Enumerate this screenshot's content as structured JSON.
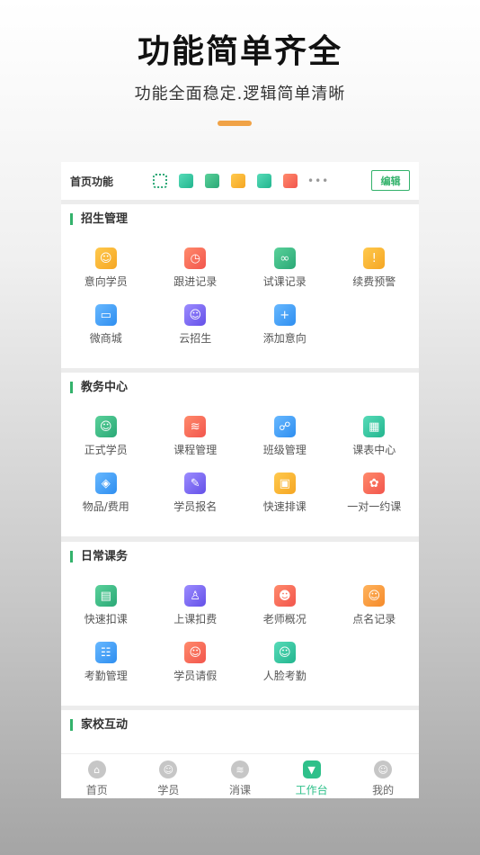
{
  "hero": {
    "title": "功能简单齐全",
    "subtitle": "功能全面稳定.逻辑简单清晰"
  },
  "quickbar": {
    "title": "首页功能",
    "icons": [
      "qrcode-icon",
      "follow-icon",
      "trial-icon",
      "student-icon",
      "teacher-icon",
      "sign-icon"
    ],
    "more": "•••",
    "edit_label": "编辑"
  },
  "sections": [
    {
      "title": "招生管理",
      "items": [
        {
          "label": "意向学员",
          "icon": "intent-student-icon",
          "glyph": "☺",
          "color": "yellow"
        },
        {
          "label": "跟进记录",
          "icon": "follow-record-icon",
          "glyph": "◷",
          "color": "red"
        },
        {
          "label": "试课记录",
          "icon": "trial-record-icon",
          "glyph": "∞",
          "color": "green"
        },
        {
          "label": "续费预警",
          "icon": "renew-alert-icon",
          "glyph": "!",
          "color": "yellow"
        },
        {
          "label": "微商城",
          "icon": "micro-mall-icon",
          "glyph": "▭",
          "color": "blue"
        },
        {
          "label": "云招生",
          "icon": "cloud-recruit-icon",
          "glyph": "☺",
          "color": "purple"
        },
        {
          "label": "添加意向",
          "icon": "add-intent-icon",
          "glyph": "+",
          "color": "blue"
        }
      ]
    },
    {
      "title": "教务中心",
      "items": [
        {
          "label": "正式学员",
          "icon": "formal-student-icon",
          "glyph": "☺",
          "color": "green"
        },
        {
          "label": "课程管理",
          "icon": "course-manage-icon",
          "glyph": "≋",
          "color": "red"
        },
        {
          "label": "班级管理",
          "icon": "class-manage-icon",
          "glyph": "☍",
          "color": "blue"
        },
        {
          "label": "课表中心",
          "icon": "schedule-center-icon",
          "glyph": "▦",
          "color": "teal"
        },
        {
          "label": "物品/费用",
          "icon": "goods-fee-icon",
          "glyph": "◈",
          "color": "blue"
        },
        {
          "label": "学员报名",
          "icon": "student-enroll-icon",
          "glyph": "✎",
          "color": "purple"
        },
        {
          "label": "快速排课",
          "icon": "quick-schedule-icon",
          "glyph": "▣",
          "color": "yellow"
        },
        {
          "label": "一对一约课",
          "icon": "one-on-one-icon",
          "glyph": "✿",
          "color": "red"
        }
      ]
    },
    {
      "title": "日常课务",
      "items": [
        {
          "label": "快速扣课",
          "icon": "quick-deduct-icon",
          "glyph": "▤",
          "color": "green"
        },
        {
          "label": "上课扣费",
          "icon": "class-fee-icon",
          "glyph": "♙",
          "color": "purple"
        },
        {
          "label": "老师概况",
          "icon": "teacher-overview-icon",
          "glyph": "☻",
          "color": "red"
        },
        {
          "label": "点名记录",
          "icon": "rollcall-record-icon",
          "glyph": "☺",
          "color": "orange"
        },
        {
          "label": "考勤管理",
          "icon": "attendance-manage-icon",
          "glyph": "☷",
          "color": "blue"
        },
        {
          "label": "学员请假",
          "icon": "student-leave-icon",
          "glyph": "☺",
          "color": "red"
        },
        {
          "label": "人脸考勤",
          "icon": "face-attendance-icon",
          "glyph": "☺",
          "color": "teal"
        }
      ]
    },
    {
      "title": "家校互动",
      "items": []
    }
  ],
  "tabbar": [
    {
      "label": "首页",
      "icon": "home-icon",
      "glyph": "⌂",
      "active": false
    },
    {
      "label": "学员",
      "icon": "student-tab-icon",
      "glyph": "☺",
      "active": false
    },
    {
      "label": "消课",
      "icon": "consume-class-icon",
      "glyph": "≋",
      "active": false
    },
    {
      "label": "工作台",
      "icon": "workbench-icon",
      "glyph": "▼",
      "active": true
    },
    {
      "label": "我的",
      "icon": "profile-icon",
      "glyph": "☺",
      "active": false
    }
  ]
}
